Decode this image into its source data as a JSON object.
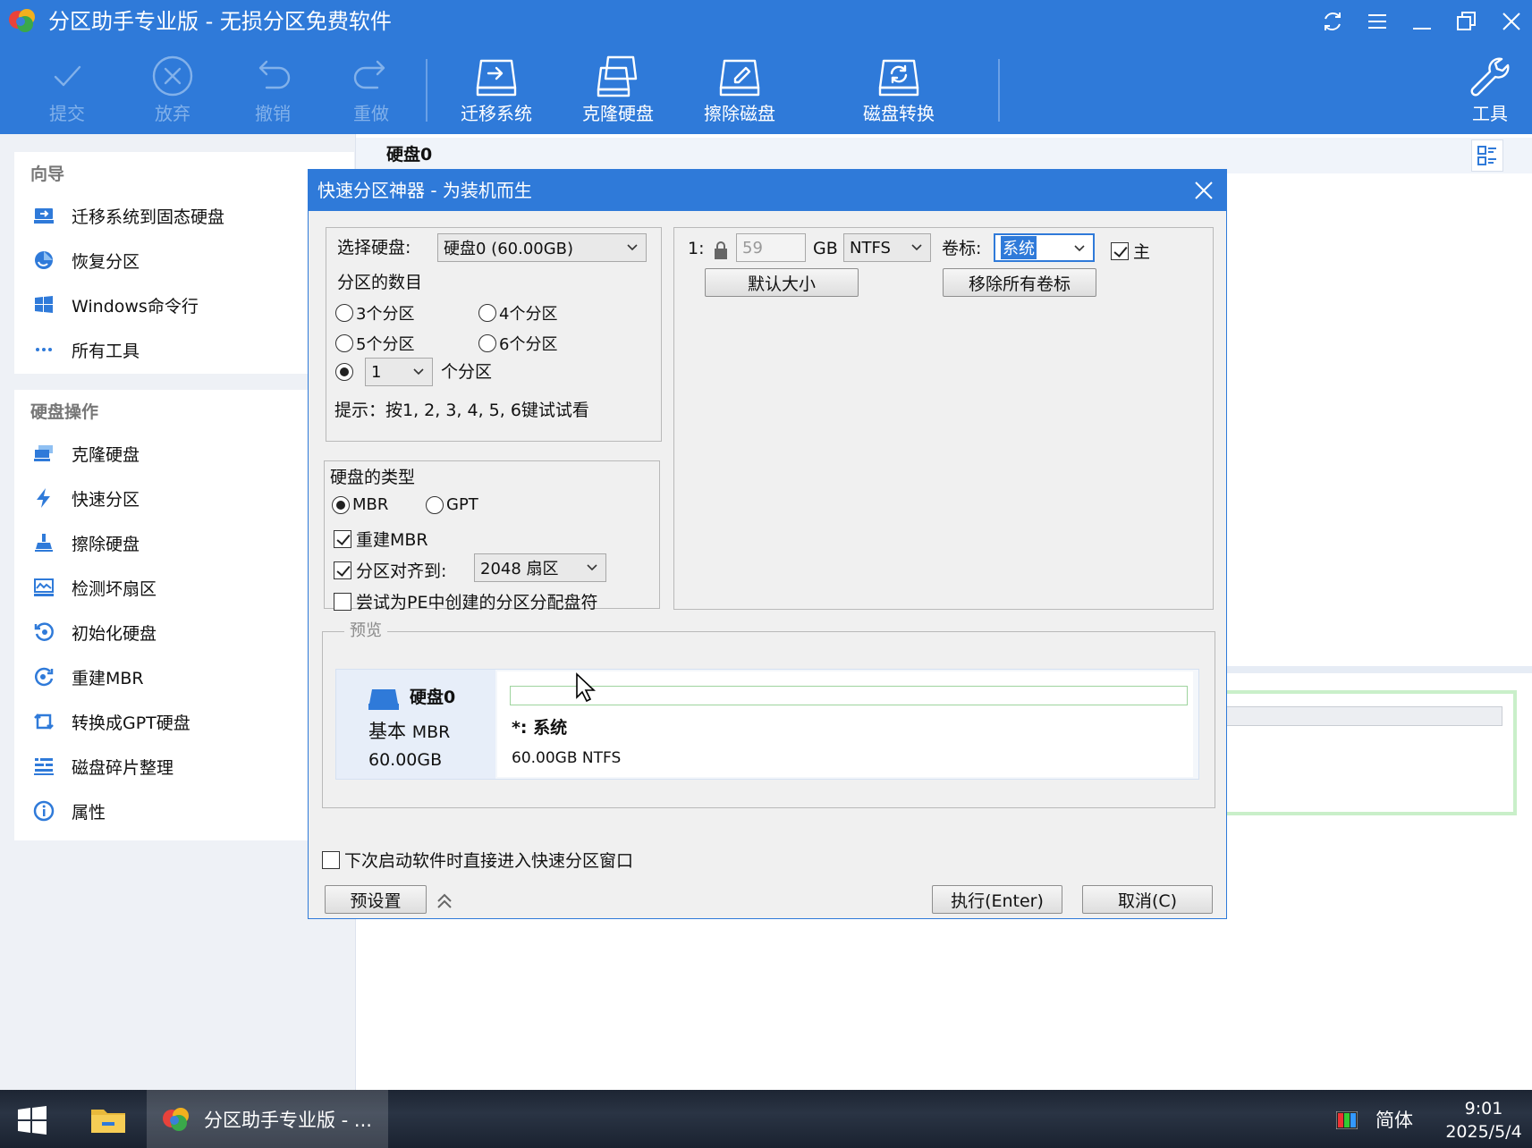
{
  "window": {
    "title": "分区助手专业版 - 无损分区免费软件"
  },
  "toolbar": {
    "commit": "提交",
    "discard": "放弃",
    "undo": "撤销",
    "redo": "重做",
    "migrate_os": "迁移系统",
    "clone_disk": "克隆硬盘",
    "wipe_disk": "擦除磁盘",
    "disk_convert": "磁盘转换",
    "tools": "工具"
  },
  "sidebar": {
    "wizard_heading": "向导",
    "wizard_items": [
      {
        "label": "迁移系统到固态硬盘",
        "icon": "migrate-ssd-icon"
      },
      {
        "label": "恢复分区",
        "icon": "recover-partition-icon"
      },
      {
        "label": "Windows命令行",
        "icon": "windows-icon"
      },
      {
        "label": "所有工具",
        "icon": "more-dots-icon"
      }
    ],
    "disk_ops_heading": "硬盘操作",
    "disk_ops_items": [
      {
        "label": "克隆硬盘",
        "icon": "clone-disk-icon"
      },
      {
        "label": "快速分区",
        "icon": "lightning-icon"
      },
      {
        "label": "擦除硬盘",
        "icon": "wipe-icon"
      },
      {
        "label": "检测坏扇区",
        "icon": "bad-sector-icon"
      },
      {
        "label": "初始化硬盘",
        "icon": "initialize-icon"
      },
      {
        "label": "重建MBR",
        "icon": "rebuild-mbr-icon"
      },
      {
        "label": "转换成GPT硬盘",
        "icon": "convert-gpt-icon"
      },
      {
        "label": "磁盘碎片整理",
        "icon": "defrag-icon"
      },
      {
        "label": "属性",
        "icon": "info-icon"
      }
    ]
  },
  "content": {
    "disk_header": "硬盘0"
  },
  "dialog": {
    "title": "快速分区神器 - 为装机而生",
    "select_disk_label": "选择硬盘:",
    "select_disk_value": "硬盘0 (60.00GB)",
    "partition_count_label": "分区的数目",
    "options": {
      "p3": "3个分区",
      "p4": "4个分区",
      "p5": "5个分区",
      "p6": "6个分区",
      "custom_value": "1",
      "custom_suffix": "个分区",
      "selected": "custom"
    },
    "hint": "提示：按1, 2, 3, 4, 5, 6键试试看",
    "disk_type_label": "硬盘的类型",
    "mbr": "MBR",
    "gpt": "GPT",
    "disk_type_selected": "MBR",
    "rebuild_mbr": "重建MBR",
    "rebuild_mbr_checked": true,
    "align_label": "分区对齐到:",
    "align_checked": true,
    "align_value": "2048 扇区",
    "assign_letter": "尝试为PE中创建的分区分配盘符",
    "assign_letter_checked": false,
    "partition_row": {
      "index": "1:",
      "size": "59",
      "unit": "GB",
      "fs": "NTFS",
      "volume_label_caption": "卷标:",
      "volume_label_value": "系统",
      "primary_label": "主",
      "primary_checked": true
    },
    "default_size_btn": "默认大小",
    "remove_labels_btn": "移除所有卷标",
    "preview_legend": "预览",
    "preview": {
      "disk_name": "硬盘0",
      "disk_kind_prefix": "基本",
      "disk_kind": "MBR",
      "disk_size": "60.00GB",
      "part_name": "*: 系统",
      "part_info": "60.00GB NTFS"
    },
    "auto_open": "下次启动软件时直接进入快速分区窗口",
    "auto_open_checked": false,
    "preset_btn": "预设置",
    "execute_btn": "执行(Enter)",
    "cancel_btn": "取消(C)"
  },
  "taskbar": {
    "app_label": "分区助手专业版 - ...",
    "ime": "简体",
    "time": "9:01",
    "date": "2025/5/4"
  },
  "colors": {
    "brand_blue": "#2f7ad9",
    "disabled_toolbar": "#82b1ea",
    "partition_green": "#9ed49e"
  }
}
